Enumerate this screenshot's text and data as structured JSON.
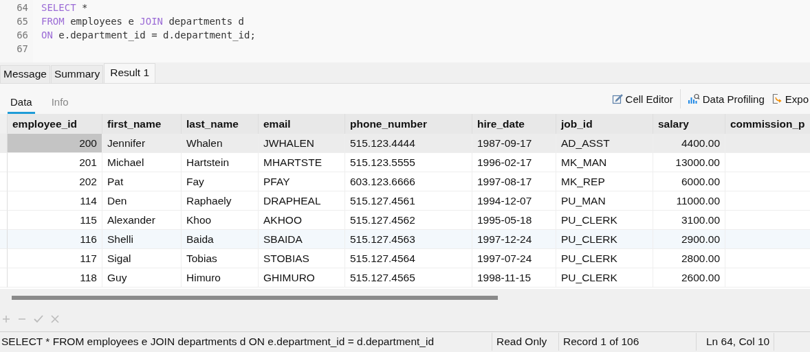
{
  "editor": {
    "lines": [
      {
        "number": "64",
        "tokens": [
          {
            "kind": "keyword",
            "text": "SELECT"
          },
          {
            "kind": "plain",
            "text": " *"
          }
        ]
      },
      {
        "number": "65",
        "tokens": [
          {
            "kind": "keyword",
            "text": "FROM"
          },
          {
            "kind": "plain",
            "text": " employees e "
          },
          {
            "kind": "keyword",
            "text": "JOIN"
          },
          {
            "kind": "plain",
            "text": " departments d"
          }
        ]
      },
      {
        "number": "66",
        "tokens": [
          {
            "kind": "keyword",
            "text": "ON"
          },
          {
            "kind": "plain",
            "text": " e.department_id = d.department_id;"
          }
        ]
      },
      {
        "number": "67"
      }
    ]
  },
  "tabs": [
    {
      "label": "Message",
      "selected": false
    },
    {
      "label": "Summary",
      "selected": false
    },
    {
      "label": "Result 1",
      "selected": true
    }
  ],
  "subtabs": [
    {
      "label": "Data",
      "selected": true
    },
    {
      "label": "Info",
      "selected": false
    }
  ],
  "toolbar": [
    {
      "kind": "edit",
      "label": "Cell Editor"
    },
    {
      "kind": "profile",
      "label": "Data Profiling"
    },
    {
      "kind": "export",
      "label": "Expo"
    }
  ],
  "table": {
    "columns": [
      {
        "label": "employee_id",
        "kind": "number"
      },
      {
        "label": "first_name",
        "kind": "text"
      },
      {
        "label": "last_name",
        "kind": "text"
      },
      {
        "label": "email",
        "kind": "text"
      },
      {
        "label": "phone_number",
        "kind": "text"
      },
      {
        "label": "hire_date",
        "kind": "text"
      },
      {
        "label": "job_id",
        "kind": "text"
      },
      {
        "label": "salary",
        "kind": "number"
      },
      {
        "label": "commission_p"
      }
    ],
    "rows": [
      {
        "selected": true,
        "hovered": false,
        "cells": [
          "200",
          "Jennifer",
          "Whalen",
          "JWHALEN",
          "515.123.4444",
          "1987-09-17",
          "AD_ASST",
          "4400.00"
        ]
      },
      {
        "selected": false,
        "hovered": false,
        "cells": [
          "201",
          "Michael",
          "Hartstein",
          "MHARTSTE",
          "515.123.5555",
          "1996-02-17",
          "MK_MAN",
          "13000.00"
        ]
      },
      {
        "selected": false,
        "hovered": false,
        "cells": [
          "202",
          "Pat",
          "Fay",
          "PFAY",
          "603.123.6666",
          "1997-08-17",
          "MK_REP",
          "6000.00"
        ]
      },
      {
        "selected": false,
        "hovered": false,
        "cells": [
          "114",
          "Den",
          "Raphaely",
          "DRAPHEAL",
          "515.127.4561",
          "1994-12-07",
          "PU_MAN",
          "11000.00"
        ]
      },
      {
        "selected": false,
        "hovered": false,
        "cells": [
          "115",
          "Alexander",
          "Khoo",
          "AKHOO",
          "515.127.4562",
          "1995-05-18",
          "PU_CLERK",
          "3100.00"
        ]
      },
      {
        "selected": false,
        "hovered": true,
        "cells": [
          "116",
          "Shelli",
          "Baida",
          "SBAIDA",
          "515.127.4563",
          "1997-12-24",
          "PU_CLERK",
          "2900.00"
        ]
      },
      {
        "selected": false,
        "hovered": false,
        "cells": [
          "117",
          "Sigal",
          "Tobias",
          "STOBIAS",
          "515.127.4564",
          "1997-07-24",
          "PU_CLERK",
          "2800.00"
        ]
      },
      {
        "selected": false,
        "hovered": false,
        "cells": [
          "118",
          "Guy",
          "Himuro",
          "GHIMURO",
          "515.127.4565",
          "1998-11-15",
          "PU_CLERK",
          "2600.00"
        ]
      }
    ]
  },
  "status_bar": {
    "query": "SELECT *  FROM employees e  JOIN departments d ON e.department_id = d.department_id",
    "mode": "Read Only",
    "record": "Record 1 of 106",
    "position": "Ln 64, Col 10"
  }
}
